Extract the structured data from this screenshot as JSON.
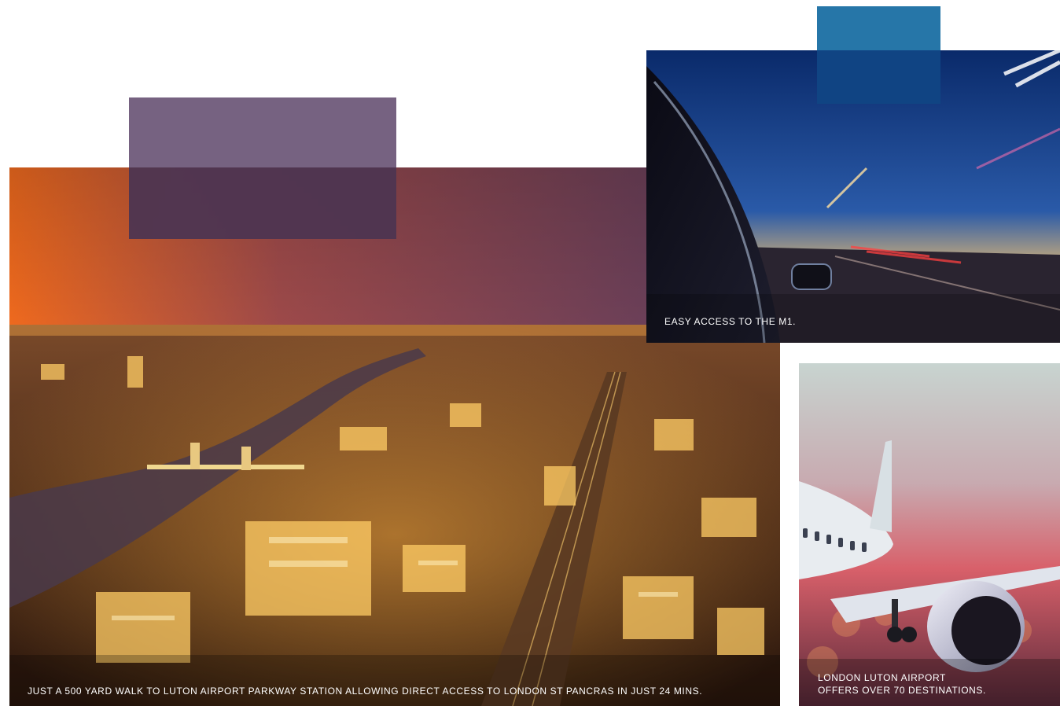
{
  "photos": {
    "city": {
      "caption": "JUST A 500 YARD WALK TO LUTON AIRPORT PARKWAY STATION ALLOWING DIRECT ACCESS TO LONDON ST PANCRAS IN JUST 24 MINS."
    },
    "road": {
      "caption": "EASY ACCESS TO THE M1."
    },
    "airport": {
      "caption_line1": "LONDON LUTON AIRPORT",
      "caption_line2": "OFFERS OVER 70 DESTINATIONS."
    }
  },
  "colors": {
    "purple_block": "#6a5576",
    "blue_block": "#1a6fa3",
    "caption_text": "#ffffff"
  }
}
